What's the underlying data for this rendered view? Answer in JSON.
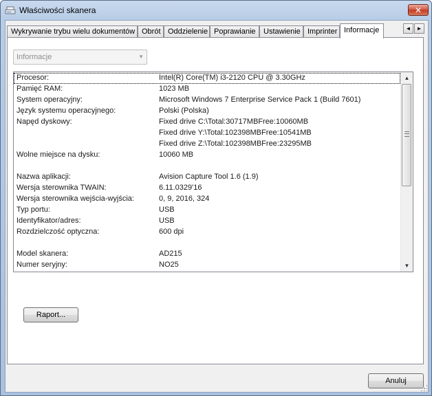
{
  "window": {
    "title": "Właściwości skanera",
    "close_label": "✕"
  },
  "tabs": [
    {
      "label": "Wykrywanie trybu wielu dokumentów",
      "active": false
    },
    {
      "label": "Obrót",
      "active": false
    },
    {
      "label": "Oddzielenie",
      "active": false
    },
    {
      "label": "Poprawianie",
      "active": false
    },
    {
      "label": "Ustawienie",
      "active": false
    },
    {
      "label": "Imprinter",
      "active": false
    },
    {
      "label": "Informacje",
      "active": true
    }
  ],
  "tab_scroll": {
    "left": "◄",
    "right": "►"
  },
  "combo": {
    "value": "Informacje",
    "arrow": "▼"
  },
  "info_rows": [
    {
      "label": "Procesor:",
      "value": "Intel(R) Core(TM) i3-2120 CPU @ 3.30GHz"
    },
    {
      "label": "Pamięć RAM:",
      "value": "1023 MB"
    },
    {
      "label": "System operacyjny:",
      "value": "Microsoft Windows 7 Enterprise Service Pack 1 (Build 7601)"
    },
    {
      "label": "Język systemu operacyjnego:",
      "value": "Polski (Polska)"
    },
    {
      "label": "Napęd dyskowy:",
      "value": "Fixed drive C:\\Total:30717MBFree:10060MB"
    },
    {
      "label": "",
      "value": "Fixed drive Y:\\Total:102398MBFree:10541MB"
    },
    {
      "label": "",
      "value": "Fixed drive Z:\\Total:102398MBFree:23295MB"
    },
    {
      "label": "Wolne miejsce na dysku:",
      "value": "10060 MB"
    },
    {
      "label": "",
      "value": ""
    },
    {
      "label": "Nazwa aplikacji:",
      "value": "Avision Capture Tool 1.6 (1.9)"
    },
    {
      "label": "Wersja sterownika TWAIN:",
      "value": "6.11.0329'16"
    },
    {
      "label": "Wersja sterownika wejścia-wyjścia:",
      "value": "0, 9, 2016, 324"
    },
    {
      "label": "Typ portu:",
      "value": "USB"
    },
    {
      "label": "Identyfikator/adres:",
      "value": "USB"
    },
    {
      "label": "Rozdzielczość optyczna:",
      "value": "600 dpi"
    },
    {
      "label": "",
      "value": ""
    },
    {
      "label": "Model skanera:",
      "value": "AD215"
    },
    {
      "label": "Numer seryjny:",
      "value": "NO25"
    }
  ],
  "scrollbar": {
    "up": "▲",
    "down": "▼"
  },
  "buttons": {
    "report": "Raport...",
    "cancel": "Anuluj"
  },
  "colors": {
    "titlebar": "#b7cce6",
    "close_button": "#c13b22",
    "panel_background": "#f0f0f0"
  }
}
